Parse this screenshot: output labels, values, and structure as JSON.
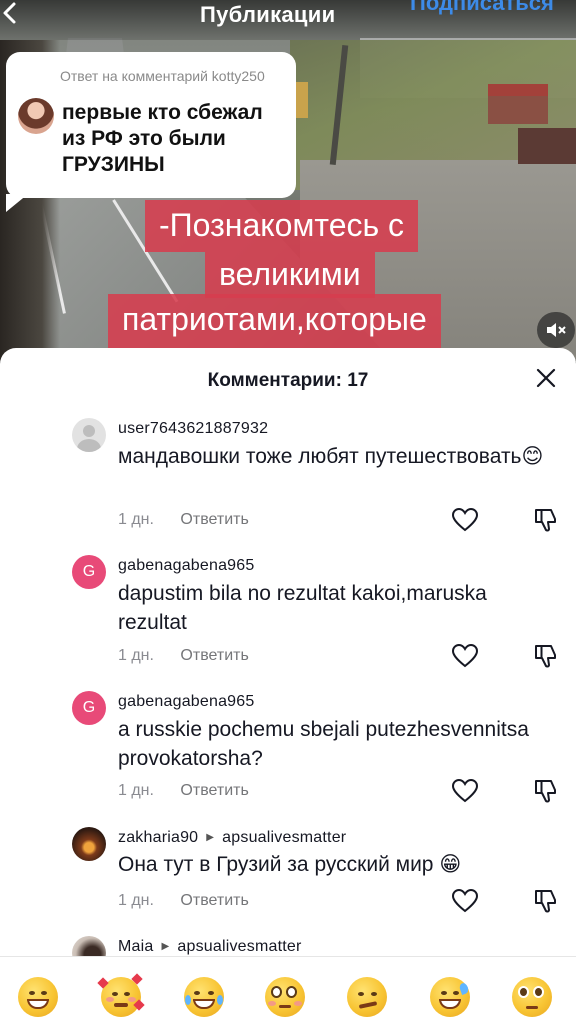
{
  "header": {
    "title": "Публикации",
    "subscribe_label": "Подписаться"
  },
  "reply_bubble": {
    "label": "Ответ на комментарий kotty250",
    "text": "первые кто сбежал из РФ это были ГРУЗИНЫ"
  },
  "video_caption": {
    "lines": [
      "-Познакомтесь с",
      "великими",
      "патриотами,которые"
    ]
  },
  "comments_sheet": {
    "title": "Комментарии: 17",
    "comments": [
      {
        "username": "user7643621887932",
        "reply_to": "",
        "text": "мандавошки тоже любят путешествовать😊",
        "time": "1 дн.",
        "reply_label": "Ответить",
        "avatar": "default-avatar"
      },
      {
        "username": "gabenagabena965",
        "reply_to": "",
        "text": "dapustim bila no rezultat kakoi,maruska rezultat",
        "time": "1 дн.",
        "reply_label": "Ответить",
        "avatar": "letter-avatar",
        "avatar_letter": "G"
      },
      {
        "username": "gabenagabena965",
        "reply_to": "",
        "text": "a russkie pochemu sbejali putezhesvennitsa provokatorsha?",
        "time": "1 дн.",
        "reply_label": "Ответить",
        "avatar": "letter-avatar",
        "avatar_letter": "G"
      },
      {
        "username": "zakharia90",
        "reply_to": "apsualivesmatter",
        "text": "Она тут в Грузий за русский мир 😁",
        "time": "1 дн.",
        "reply_label": "Ответить",
        "avatar": "photo-avatar"
      },
      {
        "username": "Maia",
        "reply_to": "apsualivesmatter",
        "text": "",
        "time": "",
        "reply_label": "",
        "avatar": "photo-avatar"
      }
    ]
  },
  "emoji_bar": {
    "emojis": [
      "grin-emoji",
      "smiling-hearts-emoji",
      "tears-of-joy-emoji",
      "flushed-emoji",
      "smirk-emoji",
      "sweat-smile-emoji",
      "pleading-emoji"
    ]
  },
  "colors": {
    "accent_blue": "#3d8be8",
    "caption_bg": "#d63e4e",
    "letter_avatar": "#e84a78",
    "text_primary": "#161823",
    "text_secondary": "#8a8b91"
  }
}
